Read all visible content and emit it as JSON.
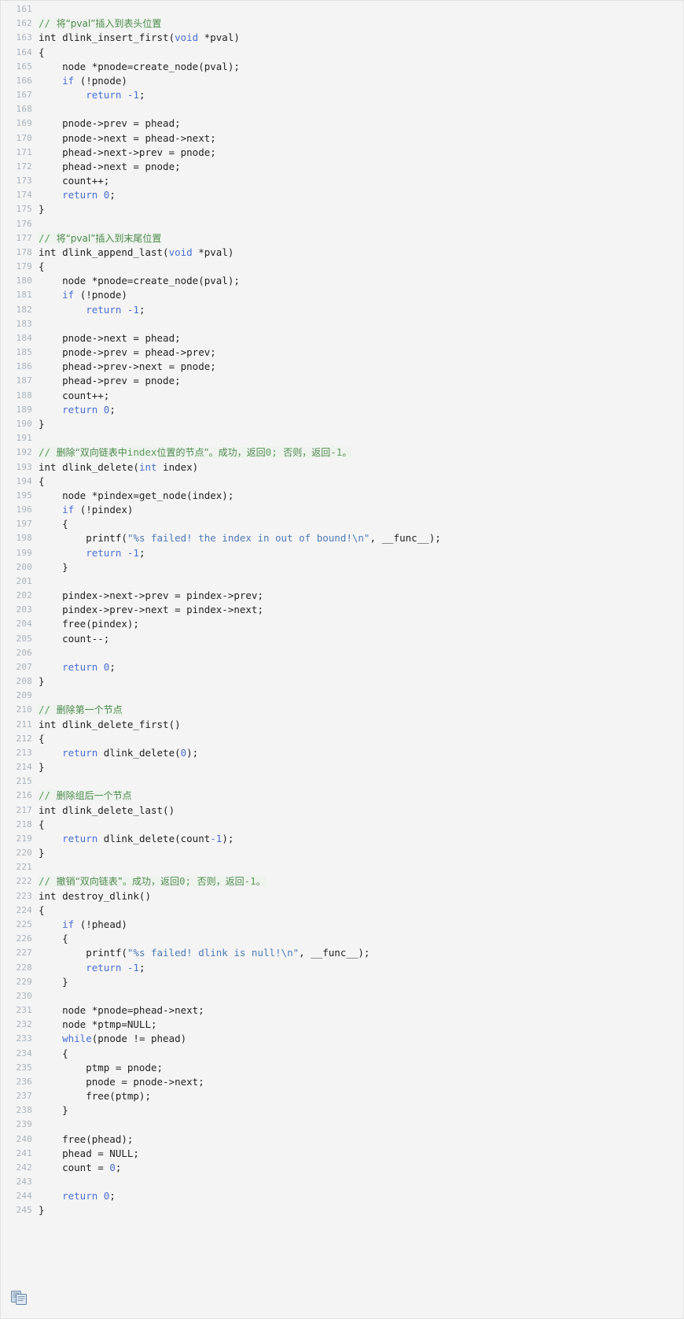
{
  "viewer": {
    "language": "c",
    "first_line_number": 161,
    "last_line_number": 245,
    "background_color": "#f4f4f4",
    "line_number_color": "#a8b3bd",
    "comment_color": "#5f9a5f",
    "keyword_color": "#4a6fd4",
    "string_color": "#4f7ab5",
    "text_color": "#222222"
  },
  "copy_button": {
    "name": "copy-to-clipboard-icon",
    "title": "复制代码"
  },
  "lines": [
    {
      "n": "161",
      "tokens": []
    },
    {
      "n": "162",
      "tokens": [
        {
          "t": "// ",
          "c": "cmt"
        },
        {
          "t": "将“pval”插入到表头位置",
          "c": "cmt-cn"
        }
      ]
    },
    {
      "n": "163",
      "tokens": [
        {
          "t": "int",
          "c": "type"
        },
        {
          "t": " dlink_insert_first(",
          "c": "pl"
        },
        {
          "t": "void",
          "c": "kw"
        },
        {
          "t": " *pval)",
          "c": "pl"
        }
      ]
    },
    {
      "n": "164",
      "tokens": [
        {
          "t": "{",
          "c": "pl"
        }
      ]
    },
    {
      "n": "165",
      "tokens": [
        {
          "t": "    node *pnode=create_node(pval);",
          "c": "pl"
        }
      ]
    },
    {
      "n": "166",
      "tokens": [
        {
          "t": "    ",
          "c": "pl"
        },
        {
          "t": "if",
          "c": "kw"
        },
        {
          "t": " (!pnode)",
          "c": "pl"
        }
      ]
    },
    {
      "n": "167",
      "tokens": [
        {
          "t": "        ",
          "c": "pl"
        },
        {
          "t": "return",
          "c": "kw"
        },
        {
          "t": " ",
          "c": "pl"
        },
        {
          "t": "-1",
          "c": "num"
        },
        {
          "t": ";",
          "c": "pl"
        }
      ]
    },
    {
      "n": "168",
      "tokens": []
    },
    {
      "n": "169",
      "tokens": [
        {
          "t": "    pnode->prev = phead;",
          "c": "pl"
        }
      ]
    },
    {
      "n": "170",
      "tokens": [
        {
          "t": "    pnode->next = phead->next;",
          "c": "pl"
        }
      ]
    },
    {
      "n": "171",
      "tokens": [
        {
          "t": "    phead->next->prev = pnode;",
          "c": "pl"
        }
      ]
    },
    {
      "n": "172",
      "tokens": [
        {
          "t": "    phead->next = pnode;",
          "c": "pl"
        }
      ]
    },
    {
      "n": "173",
      "tokens": [
        {
          "t": "    count++;",
          "c": "pl"
        }
      ]
    },
    {
      "n": "174",
      "tokens": [
        {
          "t": "    ",
          "c": "pl"
        },
        {
          "t": "return",
          "c": "kw"
        },
        {
          "t": " ",
          "c": "pl"
        },
        {
          "t": "0",
          "c": "num"
        },
        {
          "t": ";",
          "c": "pl"
        }
      ]
    },
    {
      "n": "175",
      "tokens": [
        {
          "t": "}",
          "c": "pl"
        }
      ]
    },
    {
      "n": "176",
      "tokens": []
    },
    {
      "n": "177",
      "tokens": [
        {
          "t": "// ",
          "c": "cmt"
        },
        {
          "t": "将“pval”插入到末尾位置",
          "c": "cmt-cn"
        }
      ]
    },
    {
      "n": "178",
      "tokens": [
        {
          "t": "int",
          "c": "type"
        },
        {
          "t": " dlink_append_last(",
          "c": "pl"
        },
        {
          "t": "void",
          "c": "kw"
        },
        {
          "t": " *pval)",
          "c": "pl"
        }
      ]
    },
    {
      "n": "179",
      "tokens": [
        {
          "t": "{",
          "c": "pl"
        }
      ]
    },
    {
      "n": "180",
      "tokens": [
        {
          "t": "    node *pnode=create_node(pval);",
          "c": "pl"
        }
      ]
    },
    {
      "n": "181",
      "tokens": [
        {
          "t": "    ",
          "c": "pl"
        },
        {
          "t": "if",
          "c": "kw"
        },
        {
          "t": " (!pnode)",
          "c": "pl"
        }
      ]
    },
    {
      "n": "182",
      "tokens": [
        {
          "t": "        ",
          "c": "pl"
        },
        {
          "t": "return",
          "c": "kw"
        },
        {
          "t": " ",
          "c": "pl"
        },
        {
          "t": "-1",
          "c": "num"
        },
        {
          "t": ";",
          "c": "pl"
        }
      ]
    },
    {
      "n": "183",
      "tokens": []
    },
    {
      "n": "184",
      "tokens": [
        {
          "t": "    pnode->next = phead;",
          "c": "pl"
        }
      ]
    },
    {
      "n": "185",
      "tokens": [
        {
          "t": "    pnode->prev = phead->prev;",
          "c": "pl"
        }
      ]
    },
    {
      "n": "186",
      "tokens": [
        {
          "t": "    phead->prev->next = pnode;",
          "c": "pl"
        }
      ]
    },
    {
      "n": "187",
      "tokens": [
        {
          "t": "    phead->prev = pnode;",
          "c": "pl"
        }
      ]
    },
    {
      "n": "188",
      "tokens": [
        {
          "t": "    count++;",
          "c": "pl"
        }
      ]
    },
    {
      "n": "189",
      "tokens": [
        {
          "t": "    ",
          "c": "pl"
        },
        {
          "t": "return",
          "c": "kw"
        },
        {
          "t": " ",
          "c": "pl"
        },
        {
          "t": "0",
          "c": "num"
        },
        {
          "t": ";",
          "c": "pl"
        }
      ]
    },
    {
      "n": "190",
      "tokens": [
        {
          "t": "}",
          "c": "pl"
        }
      ]
    },
    {
      "n": "191",
      "tokens": []
    },
    {
      "n": "192",
      "tokens": [
        {
          "t": "// ",
          "c": "cmt"
        },
        {
          "t": "删除“双向链表中",
          "c": "cmt-cn"
        },
        {
          "t": "index",
          "c": "cmt"
        },
        {
          "t": "位置的节点”。成功，返回",
          "c": "cmt-cn"
        },
        {
          "t": "0",
          "c": "cmt"
        },
        {
          "t": "; ",
          "c": "cmt"
        },
        {
          "t": "否则，返回",
          "c": "cmt-cn"
        },
        {
          "t": "-1",
          "c": "cmt"
        },
        {
          "t": "。",
          "c": "cmt-cn"
        }
      ]
    },
    {
      "n": "193",
      "tokens": [
        {
          "t": "int",
          "c": "type"
        },
        {
          "t": " dlink_delete(",
          "c": "pl"
        },
        {
          "t": "int",
          "c": "kw"
        },
        {
          "t": " index)",
          "c": "pl"
        }
      ]
    },
    {
      "n": "194",
      "tokens": [
        {
          "t": "{",
          "c": "pl"
        }
      ]
    },
    {
      "n": "195",
      "tokens": [
        {
          "t": "    node *pindex=get_node(index);",
          "c": "pl"
        }
      ]
    },
    {
      "n": "196",
      "tokens": [
        {
          "t": "    ",
          "c": "pl"
        },
        {
          "t": "if",
          "c": "kw"
        },
        {
          "t": " (!pindex)",
          "c": "pl"
        }
      ]
    },
    {
      "n": "197",
      "tokens": [
        {
          "t": "    {",
          "c": "pl"
        }
      ]
    },
    {
      "n": "198",
      "tokens": [
        {
          "t": "        printf(",
          "c": "pl"
        },
        {
          "t": "\"%s failed! the index in out of bound!\\n\"",
          "c": "str"
        },
        {
          "t": ", __func__);",
          "c": "pl"
        }
      ]
    },
    {
      "n": "199",
      "tokens": [
        {
          "t": "        ",
          "c": "pl"
        },
        {
          "t": "return",
          "c": "kw"
        },
        {
          "t": " ",
          "c": "pl"
        },
        {
          "t": "-1",
          "c": "num"
        },
        {
          "t": ";",
          "c": "pl"
        }
      ]
    },
    {
      "n": "200",
      "tokens": [
        {
          "t": "    }",
          "c": "pl"
        }
      ]
    },
    {
      "n": "201",
      "tokens": []
    },
    {
      "n": "202",
      "tokens": [
        {
          "t": "    pindex->next->prev = pindex->prev;",
          "c": "pl"
        }
      ]
    },
    {
      "n": "203",
      "tokens": [
        {
          "t": "    pindex->prev->next = pindex->next;",
          "c": "pl"
        }
      ]
    },
    {
      "n": "204",
      "tokens": [
        {
          "t": "    free(pindex);",
          "c": "pl"
        }
      ]
    },
    {
      "n": "205",
      "tokens": [
        {
          "t": "    count--;",
          "c": "pl"
        }
      ]
    },
    {
      "n": "206",
      "tokens": []
    },
    {
      "n": "207",
      "tokens": [
        {
          "t": "    ",
          "c": "pl"
        },
        {
          "t": "return",
          "c": "kw"
        },
        {
          "t": " ",
          "c": "pl"
        },
        {
          "t": "0",
          "c": "num"
        },
        {
          "t": ";",
          "c": "pl"
        }
      ]
    },
    {
      "n": "208",
      "tokens": [
        {
          "t": "}",
          "c": "pl"
        }
      ]
    },
    {
      "n": "209",
      "tokens": []
    },
    {
      "n": "210",
      "tokens": [
        {
          "t": "// ",
          "c": "cmt"
        },
        {
          "t": "删除第一个节点",
          "c": "cmt-cn"
        }
      ]
    },
    {
      "n": "211",
      "tokens": [
        {
          "t": "int",
          "c": "type"
        },
        {
          "t": " dlink_delete_first()",
          "c": "pl"
        }
      ]
    },
    {
      "n": "212",
      "tokens": [
        {
          "t": "{",
          "c": "pl"
        }
      ]
    },
    {
      "n": "213",
      "tokens": [
        {
          "t": "    ",
          "c": "pl"
        },
        {
          "t": "return",
          "c": "kw"
        },
        {
          "t": " dlink_delete(",
          "c": "pl"
        },
        {
          "t": "0",
          "c": "num"
        },
        {
          "t": ");",
          "c": "pl"
        }
      ]
    },
    {
      "n": "214",
      "tokens": [
        {
          "t": "}",
          "c": "pl"
        }
      ]
    },
    {
      "n": "215",
      "tokens": []
    },
    {
      "n": "216",
      "tokens": [
        {
          "t": "// ",
          "c": "cmt"
        },
        {
          "t": "删除组后一个节点",
          "c": "cmt-cn"
        }
      ]
    },
    {
      "n": "217",
      "tokens": [
        {
          "t": "int",
          "c": "type"
        },
        {
          "t": " dlink_delete_last()",
          "c": "pl"
        }
      ]
    },
    {
      "n": "218",
      "tokens": [
        {
          "t": "{",
          "c": "pl"
        }
      ]
    },
    {
      "n": "219",
      "tokens": [
        {
          "t": "    ",
          "c": "pl"
        },
        {
          "t": "return",
          "c": "kw"
        },
        {
          "t": " dlink_delete(count",
          "c": "pl"
        },
        {
          "t": "-1",
          "c": "num"
        },
        {
          "t": ");",
          "c": "pl"
        }
      ]
    },
    {
      "n": "220",
      "tokens": [
        {
          "t": "}",
          "c": "pl"
        }
      ]
    },
    {
      "n": "221",
      "tokens": []
    },
    {
      "n": "222",
      "tokens": [
        {
          "t": "// ",
          "c": "cmt"
        },
        {
          "t": "撤销“双向链表”。成功，返回",
          "c": "cmt-cn"
        },
        {
          "t": "0",
          "c": "cmt"
        },
        {
          "t": "; ",
          "c": "cmt"
        },
        {
          "t": "否则，返回",
          "c": "cmt-cn"
        },
        {
          "t": "-1",
          "c": "cmt"
        },
        {
          "t": "。",
          "c": "cmt-cn"
        }
      ]
    },
    {
      "n": "223",
      "tokens": [
        {
          "t": "int",
          "c": "type"
        },
        {
          "t": " destroy_dlink()",
          "c": "pl"
        }
      ]
    },
    {
      "n": "224",
      "tokens": [
        {
          "t": "{",
          "c": "pl"
        }
      ]
    },
    {
      "n": "225",
      "tokens": [
        {
          "t": "    ",
          "c": "pl"
        },
        {
          "t": "if",
          "c": "kw"
        },
        {
          "t": " (!phead)",
          "c": "pl"
        }
      ]
    },
    {
      "n": "226",
      "tokens": [
        {
          "t": "    {",
          "c": "pl"
        }
      ]
    },
    {
      "n": "227",
      "tokens": [
        {
          "t": "        printf(",
          "c": "pl"
        },
        {
          "t": "\"%s failed! dlink is null!\\n\"",
          "c": "str"
        },
        {
          "t": ", __func__);",
          "c": "pl"
        }
      ]
    },
    {
      "n": "228",
      "tokens": [
        {
          "t": "        ",
          "c": "pl"
        },
        {
          "t": "return",
          "c": "kw"
        },
        {
          "t": " ",
          "c": "pl"
        },
        {
          "t": "-1",
          "c": "num"
        },
        {
          "t": ";",
          "c": "pl"
        }
      ]
    },
    {
      "n": "229",
      "tokens": [
        {
          "t": "    }",
          "c": "pl"
        }
      ]
    },
    {
      "n": "230",
      "tokens": []
    },
    {
      "n": "231",
      "tokens": [
        {
          "t": "    node *pnode=phead->next;",
          "c": "pl"
        }
      ]
    },
    {
      "n": "232",
      "tokens": [
        {
          "t": "    node *ptmp=NULL;",
          "c": "pl"
        }
      ]
    },
    {
      "n": "233",
      "tokens": [
        {
          "t": "    ",
          "c": "pl"
        },
        {
          "t": "while",
          "c": "kw"
        },
        {
          "t": "(pnode != phead)",
          "c": "pl"
        }
      ]
    },
    {
      "n": "234",
      "tokens": [
        {
          "t": "    {",
          "c": "pl"
        }
      ]
    },
    {
      "n": "235",
      "tokens": [
        {
          "t": "        ptmp = pnode;",
          "c": "pl"
        }
      ]
    },
    {
      "n": "236",
      "tokens": [
        {
          "t": "        pnode = pnode->next;",
          "c": "pl"
        }
      ]
    },
    {
      "n": "237",
      "tokens": [
        {
          "t": "        free(ptmp);",
          "c": "pl"
        }
      ]
    },
    {
      "n": "238",
      "tokens": [
        {
          "t": "    }",
          "c": "pl"
        }
      ]
    },
    {
      "n": "239",
      "tokens": []
    },
    {
      "n": "240",
      "tokens": [
        {
          "t": "    free(phead);",
          "c": "pl"
        }
      ]
    },
    {
      "n": "241",
      "tokens": [
        {
          "t": "    phead = NULL;",
          "c": "pl"
        }
      ]
    },
    {
      "n": "242",
      "tokens": [
        {
          "t": "    count = ",
          "c": "pl"
        },
        {
          "t": "0",
          "c": "num"
        },
        {
          "t": ";",
          "c": "pl"
        }
      ]
    },
    {
      "n": "243",
      "tokens": []
    },
    {
      "n": "244",
      "tokens": [
        {
          "t": "    ",
          "c": "pl"
        },
        {
          "t": "return",
          "c": "kw"
        },
        {
          "t": " ",
          "c": "pl"
        },
        {
          "t": "0",
          "c": "num"
        },
        {
          "t": ";",
          "c": "pl"
        }
      ]
    },
    {
      "n": "245",
      "tokens": [
        {
          "t": "}",
          "c": "pl"
        }
      ]
    }
  ]
}
